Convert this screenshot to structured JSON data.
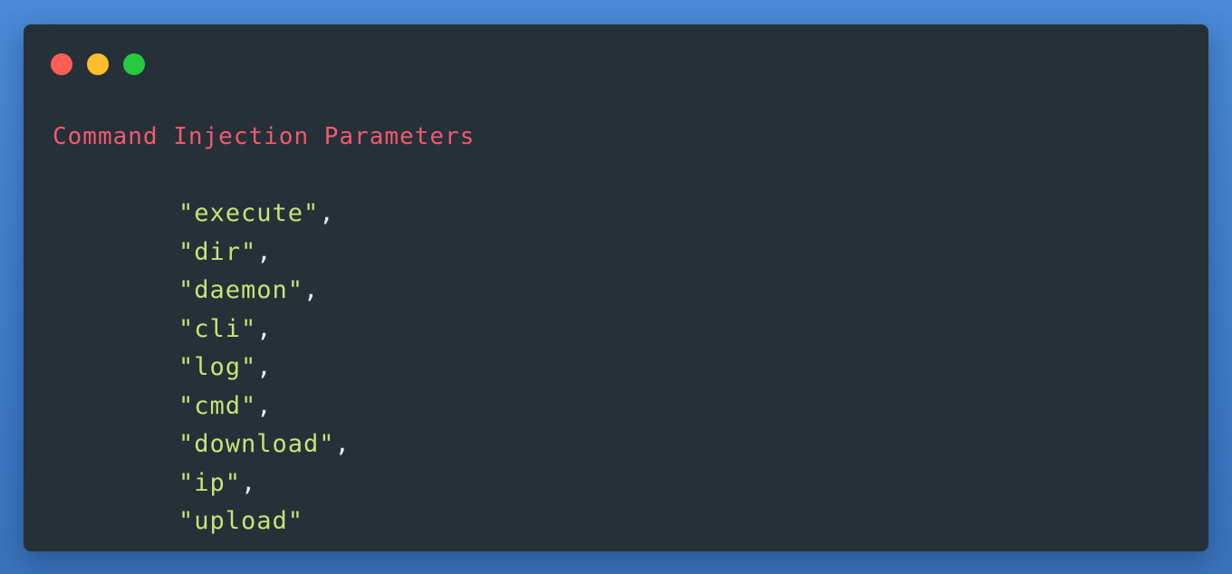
{
  "window": {
    "background": "#263038",
    "controls": [
      {
        "name": "close-control",
        "color": "#ff5f56"
      },
      {
        "name": "minimize-control",
        "color": "#ffbd2e"
      },
      {
        "name": "maximize-control",
        "color": "#27c93f"
      }
    ]
  },
  "title": {
    "text": "Command Injection Parameters",
    "color": "#f2596f"
  },
  "code": {
    "string_color": "#c5e478",
    "lines": [
      {
        "value": "\"execute\"",
        "comma": ","
      },
      {
        "value": "\"dir\"",
        "comma": ","
      },
      {
        "value": "\"daemon\"",
        "comma": ","
      },
      {
        "value": "\"cli\"",
        "comma": ","
      },
      {
        "value": "\"log\"",
        "comma": ","
      },
      {
        "value": "\"cmd\"",
        "comma": ","
      },
      {
        "value": "\"download\"",
        "comma": ","
      },
      {
        "value": "\"ip\"",
        "comma": ","
      },
      {
        "value": "\"upload\"",
        "comma": ""
      }
    ]
  }
}
